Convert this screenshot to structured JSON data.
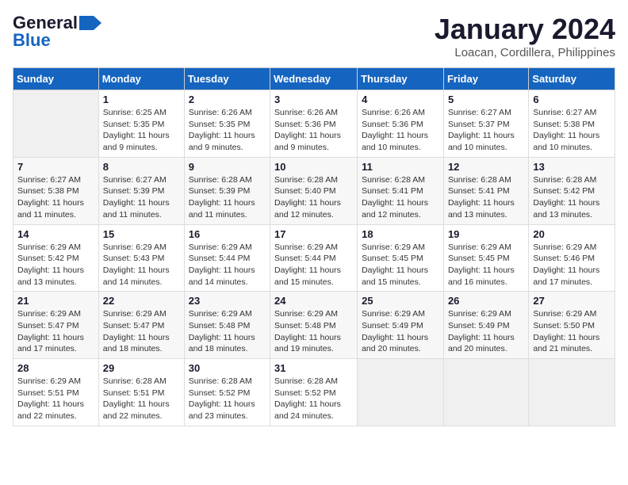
{
  "logo": {
    "general": "General",
    "blue": "Blue"
  },
  "title": "January 2024",
  "location": "Loacan, Cordillera, Philippines",
  "days_of_week": [
    "Sunday",
    "Monday",
    "Tuesday",
    "Wednesday",
    "Thursday",
    "Friday",
    "Saturday"
  ],
  "weeks": [
    [
      {
        "day": "",
        "empty": true
      },
      {
        "day": "1",
        "sunrise": "Sunrise: 6:25 AM",
        "sunset": "Sunset: 5:35 PM",
        "daylight": "Daylight: 11 hours and 9 minutes."
      },
      {
        "day": "2",
        "sunrise": "Sunrise: 6:26 AM",
        "sunset": "Sunset: 5:35 PM",
        "daylight": "Daylight: 11 hours and 9 minutes."
      },
      {
        "day": "3",
        "sunrise": "Sunrise: 6:26 AM",
        "sunset": "Sunset: 5:36 PM",
        "daylight": "Daylight: 11 hours and 9 minutes."
      },
      {
        "day": "4",
        "sunrise": "Sunrise: 6:26 AM",
        "sunset": "Sunset: 5:36 PM",
        "daylight": "Daylight: 11 hours and 10 minutes."
      },
      {
        "day": "5",
        "sunrise": "Sunrise: 6:27 AM",
        "sunset": "Sunset: 5:37 PM",
        "daylight": "Daylight: 11 hours and 10 minutes."
      },
      {
        "day": "6",
        "sunrise": "Sunrise: 6:27 AM",
        "sunset": "Sunset: 5:38 PM",
        "daylight": "Daylight: 11 hours and 10 minutes."
      }
    ],
    [
      {
        "day": "7",
        "sunrise": "Sunrise: 6:27 AM",
        "sunset": "Sunset: 5:38 PM",
        "daylight": "Daylight: 11 hours and 11 minutes."
      },
      {
        "day": "8",
        "sunrise": "Sunrise: 6:27 AM",
        "sunset": "Sunset: 5:39 PM",
        "daylight": "Daylight: 11 hours and 11 minutes."
      },
      {
        "day": "9",
        "sunrise": "Sunrise: 6:28 AM",
        "sunset": "Sunset: 5:39 PM",
        "daylight": "Daylight: 11 hours and 11 minutes."
      },
      {
        "day": "10",
        "sunrise": "Sunrise: 6:28 AM",
        "sunset": "Sunset: 5:40 PM",
        "daylight": "Daylight: 11 hours and 12 minutes."
      },
      {
        "day": "11",
        "sunrise": "Sunrise: 6:28 AM",
        "sunset": "Sunset: 5:41 PM",
        "daylight": "Daylight: 11 hours and 12 minutes."
      },
      {
        "day": "12",
        "sunrise": "Sunrise: 6:28 AM",
        "sunset": "Sunset: 5:41 PM",
        "daylight": "Daylight: 11 hours and 13 minutes."
      },
      {
        "day": "13",
        "sunrise": "Sunrise: 6:28 AM",
        "sunset": "Sunset: 5:42 PM",
        "daylight": "Daylight: 11 hours and 13 minutes."
      }
    ],
    [
      {
        "day": "14",
        "sunrise": "Sunrise: 6:29 AM",
        "sunset": "Sunset: 5:42 PM",
        "daylight": "Daylight: 11 hours and 13 minutes."
      },
      {
        "day": "15",
        "sunrise": "Sunrise: 6:29 AM",
        "sunset": "Sunset: 5:43 PM",
        "daylight": "Daylight: 11 hours and 14 minutes."
      },
      {
        "day": "16",
        "sunrise": "Sunrise: 6:29 AM",
        "sunset": "Sunset: 5:44 PM",
        "daylight": "Daylight: 11 hours and 14 minutes."
      },
      {
        "day": "17",
        "sunrise": "Sunrise: 6:29 AM",
        "sunset": "Sunset: 5:44 PM",
        "daylight": "Daylight: 11 hours and 15 minutes."
      },
      {
        "day": "18",
        "sunrise": "Sunrise: 6:29 AM",
        "sunset": "Sunset: 5:45 PM",
        "daylight": "Daylight: 11 hours and 15 minutes."
      },
      {
        "day": "19",
        "sunrise": "Sunrise: 6:29 AM",
        "sunset": "Sunset: 5:45 PM",
        "daylight": "Daylight: 11 hours and 16 minutes."
      },
      {
        "day": "20",
        "sunrise": "Sunrise: 6:29 AM",
        "sunset": "Sunset: 5:46 PM",
        "daylight": "Daylight: 11 hours and 17 minutes."
      }
    ],
    [
      {
        "day": "21",
        "sunrise": "Sunrise: 6:29 AM",
        "sunset": "Sunset: 5:47 PM",
        "daylight": "Daylight: 11 hours and 17 minutes."
      },
      {
        "day": "22",
        "sunrise": "Sunrise: 6:29 AM",
        "sunset": "Sunset: 5:47 PM",
        "daylight": "Daylight: 11 hours and 18 minutes."
      },
      {
        "day": "23",
        "sunrise": "Sunrise: 6:29 AM",
        "sunset": "Sunset: 5:48 PM",
        "daylight": "Daylight: 11 hours and 18 minutes."
      },
      {
        "day": "24",
        "sunrise": "Sunrise: 6:29 AM",
        "sunset": "Sunset: 5:48 PM",
        "daylight": "Daylight: 11 hours and 19 minutes."
      },
      {
        "day": "25",
        "sunrise": "Sunrise: 6:29 AM",
        "sunset": "Sunset: 5:49 PM",
        "daylight": "Daylight: 11 hours and 20 minutes."
      },
      {
        "day": "26",
        "sunrise": "Sunrise: 6:29 AM",
        "sunset": "Sunset: 5:49 PM",
        "daylight": "Daylight: 11 hours and 20 minutes."
      },
      {
        "day": "27",
        "sunrise": "Sunrise: 6:29 AM",
        "sunset": "Sunset: 5:50 PM",
        "daylight": "Daylight: 11 hours and 21 minutes."
      }
    ],
    [
      {
        "day": "28",
        "sunrise": "Sunrise: 6:29 AM",
        "sunset": "Sunset: 5:51 PM",
        "daylight": "Daylight: 11 hours and 22 minutes."
      },
      {
        "day": "29",
        "sunrise": "Sunrise: 6:28 AM",
        "sunset": "Sunset: 5:51 PM",
        "daylight": "Daylight: 11 hours and 22 minutes."
      },
      {
        "day": "30",
        "sunrise": "Sunrise: 6:28 AM",
        "sunset": "Sunset: 5:52 PM",
        "daylight": "Daylight: 11 hours and 23 minutes."
      },
      {
        "day": "31",
        "sunrise": "Sunrise: 6:28 AM",
        "sunset": "Sunset: 5:52 PM",
        "daylight": "Daylight: 11 hours and 24 minutes."
      },
      {
        "day": "",
        "empty": true
      },
      {
        "day": "",
        "empty": true
      },
      {
        "day": "",
        "empty": true
      }
    ]
  ]
}
